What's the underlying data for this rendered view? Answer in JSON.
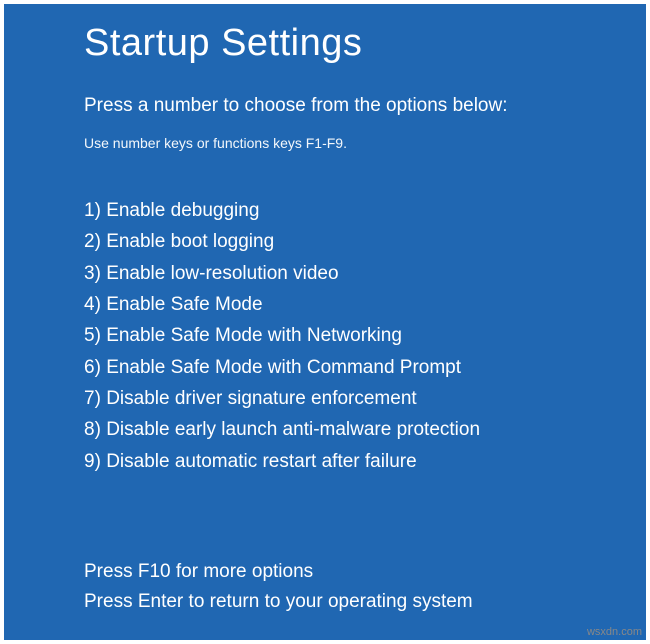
{
  "title": "Startup Settings",
  "subtitle": "Press a number to choose from the options below:",
  "hint": "Use number keys or functions keys F1-F9.",
  "options": [
    {
      "num": "1",
      "label": "Enable debugging"
    },
    {
      "num": "2",
      "label": "Enable boot logging"
    },
    {
      "num": "3",
      "label": "Enable low-resolution video"
    },
    {
      "num": "4",
      "label": "Enable Safe Mode"
    },
    {
      "num": "5",
      "label": "Enable Safe Mode with Networking"
    },
    {
      "num": "6",
      "label": "Enable Safe Mode with Command Prompt"
    },
    {
      "num": "7",
      "label": "Disable driver signature enforcement"
    },
    {
      "num": "8",
      "label": "Disable early launch anti-malware protection"
    },
    {
      "num": "9",
      "label": "Disable automatic restart after failure"
    }
  ],
  "footer": {
    "more": "Press F10 for more options",
    "return": "Press Enter to return to your operating system"
  },
  "watermark": "wsxdn.com"
}
